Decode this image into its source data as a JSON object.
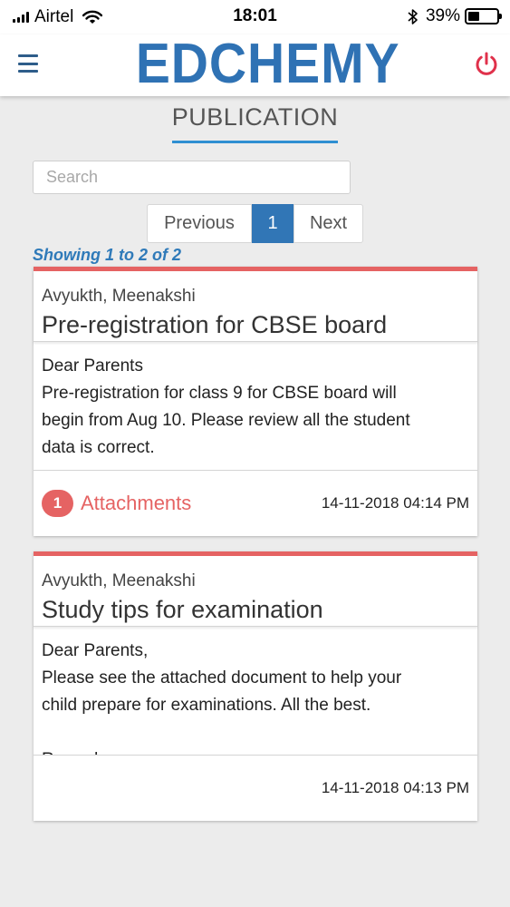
{
  "status_bar": {
    "carrier": "Airtel",
    "time": "18:01",
    "battery": "39%",
    "battery_level": 0.39
  },
  "header": {
    "logo": "EDCHEMY",
    "logo_color": "#2f72b4",
    "menu_icon": "hamburger-icon",
    "power_icon": "power-icon",
    "power_color": "#e0314b"
  },
  "page": {
    "title": "PUBLICATION"
  },
  "search": {
    "placeholder": "Search",
    "value": ""
  },
  "pagination": {
    "previous": "Previous",
    "current": "1",
    "next": "Next"
  },
  "showing": "Showing 1 to 2 of 2",
  "accent_color": "#e56363",
  "publications": [
    {
      "author": "Avyukth, Meenakshi",
      "subject": "Pre-registration for CBSE board",
      "body_lines": [
        "Dear Parents",
        "Pre-registration for class 9 for CBSE board will",
        "begin from Aug 10. Please review all the student",
        "data is correct."
      ],
      "attachment_count": "1",
      "attachment_label": "Attachments",
      "date": "14-11-2018 04:14 PM"
    },
    {
      "author": "Avyukth, Meenakshi",
      "subject": "Study tips for examination",
      "body_lines": [
        "Dear Parents,",
        "Please see the attached document to help your",
        "child prepare for examinations. All the best.",
        "",
        "Regards"
      ],
      "date": "14-11-2018 04:13 PM"
    }
  ]
}
